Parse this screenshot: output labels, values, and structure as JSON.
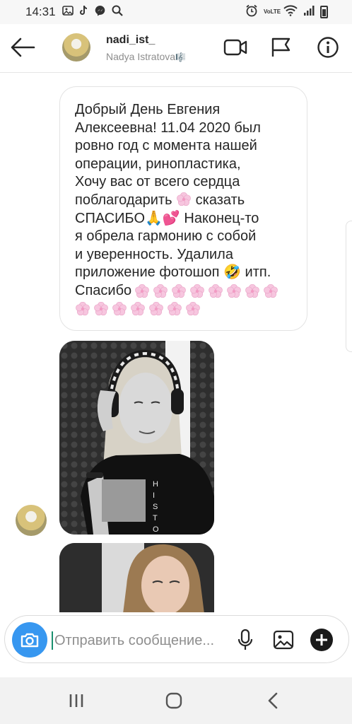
{
  "status_bar": {
    "time": "14:31",
    "network_label": "VoLTE",
    "left_icons": [
      "photo-icon",
      "tiktok-icon",
      "messenger-icon",
      "search-icon"
    ],
    "right_icons": [
      "alarm-icon",
      "volte-icon",
      "wifi-icon",
      "signal-icon",
      "battery-icon"
    ]
  },
  "header": {
    "username": "nadi_ist_",
    "full_name": "Nadya Istratova",
    "name_suffix_glyph": "🎼",
    "icons": [
      "back-arrow-icon",
      "video-call-icon",
      "flag-icon",
      "info-icon"
    ]
  },
  "message": {
    "lines": [
      "Добрый День Евгения",
      "Алексеевна! 11.04 2020 был",
      "ровно год с момента нашей",
      "операции, ринопластика,",
      "Хочу вас от всего сердца",
      "поблагодарить",
      "сказать",
      "СПАСИБО",
      "Наконец-то",
      "я обрела гармонию с собой",
      "и уверенность. Удалила",
      "приложение фотошоп",
      "итп.",
      "Спасибо"
    ],
    "emoji": {
      "pray": "🙏",
      "hearts": "💕",
      "laugh": "🤣"
    },
    "flower_count_line13": 8,
    "flower_count_line14": 7
  },
  "photos": [
    {
      "name": "photo-woman-headphones",
      "text_on_shirt": "HISTO"
    },
    {
      "name": "photo-woman-selfie"
    }
  ],
  "composer": {
    "placeholder": "Отправить сообщение...",
    "value": "",
    "icons": [
      "camera-icon",
      "microphone-icon",
      "gallery-icon",
      "add-icon"
    ]
  },
  "navbar": {
    "icons": [
      "recent-apps-icon",
      "home-icon",
      "back-icon"
    ]
  },
  "colors": {
    "accent": "#3797f0",
    "flower": "#f7c6df",
    "bubble_border": "#e3e3e3"
  }
}
